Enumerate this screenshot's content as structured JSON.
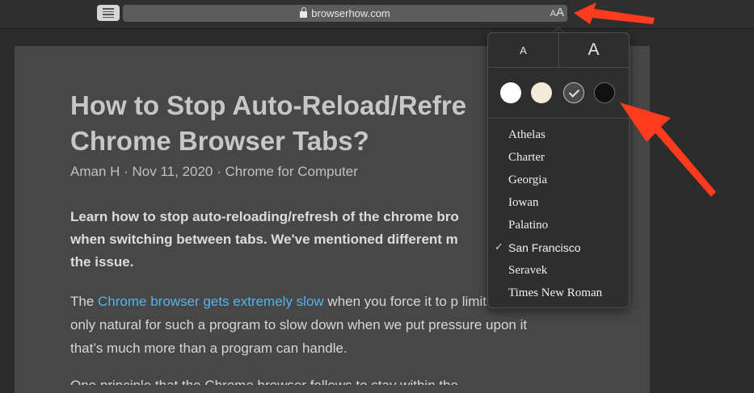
{
  "toolbar": {
    "url": "browserhow.com",
    "aa_small": "A",
    "aa_large": "A"
  },
  "article": {
    "title": "How to Stop Auto-Reload/Refre\nChrome Browser Tabs?",
    "meta": "Aman H · Nov 11, 2020 · Chrome for Computer",
    "intro": "Learn how to stop auto-reloading/refresh of the chrome bro\nwhen switching between tabs. We've mentioned different m\nthe issue.",
    "para_start": "The ",
    "para_link": "Chrome browser gets extremely slow",
    "para_rest": " when you force it to p limits. But it’s only natural for such a program to slow down when we put pressure upon it that’s much more than a program can handle.",
    "cut_text": "One principle that the Chrome browser follows to stay within the"
  },
  "popover": {
    "size_small": "A",
    "size_large": "A",
    "themes": [
      {
        "name": "white",
        "color": "#ffffff"
      },
      {
        "name": "sepia",
        "color": "#f4eadc"
      },
      {
        "name": "gray",
        "color": "#4a4a4a",
        "selected": true
      },
      {
        "name": "black",
        "color": "#111111"
      }
    ],
    "fonts": [
      "Athelas",
      "Charter",
      "Georgia",
      "Iowan",
      "Palatino",
      "San Francisco",
      "Seravek",
      "Times New Roman"
    ],
    "selected_font": "San Francisco",
    "check_glyph": "✓"
  },
  "annotation_color": "#ff3b1f"
}
